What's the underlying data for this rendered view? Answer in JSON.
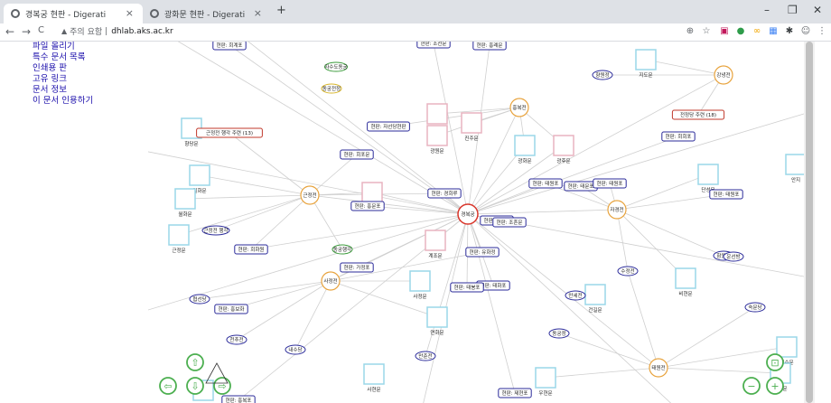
{
  "browser": {
    "tabs": [
      {
        "title": "경복궁 현판 - Digerati",
        "close": "×"
      },
      {
        "title": "광화문 현판 - Digerati",
        "close": "×"
      }
    ],
    "new_tab": "+",
    "window_controls": {
      "minimize": "–",
      "maximize": "❐",
      "close": "✕"
    },
    "nav": {
      "back": "←",
      "forward": "→",
      "reload": "C"
    },
    "url": {
      "security_icon": "▲",
      "security_text": "주의 요함",
      "separator": "|",
      "host": "dhlab.aks.ac.kr"
    }
  },
  "sidebar_menu": [
    "파일 올리기",
    "특수 문서 목록",
    "인쇄용 판",
    "고유 링크",
    "문서 정보",
    "이 문서 인용하기"
  ],
  "graph": {
    "center": "경복궁",
    "nodes": [
      {
        "label": "현판: 회계포",
        "kind": "tag"
      },
      {
        "label": "현판: 조선문",
        "kind": "tag"
      },
      {
        "label": "현판: 흥례문",
        "kind": "tag"
      },
      {
        "label": "지도문",
        "kind": "square"
      },
      {
        "label": "향원정",
        "kind": "ellipse"
      },
      {
        "label": "강녕전",
        "kind": "circle"
      },
      {
        "label": "자수도동궁",
        "kind": "ellipse-green"
      },
      {
        "label": "동궁전정",
        "kind": "ellipse-yellow"
      },
      {
        "label": "흥복전",
        "kind": "circle"
      },
      {
        "label": "전정당 주련 (18)",
        "kind": "tag-red"
      },
      {
        "label": "우정문",
        "kind": "square"
      },
      {
        "label": "현판: 자선당현판",
        "kind": "tag"
      },
      {
        "label": "광원문",
        "kind": "square"
      },
      {
        "label": "진주문",
        "kind": "square"
      },
      {
        "label": "현판: 회회포",
        "kind": "tag"
      },
      {
        "label": "향당문",
        "kind": "square"
      },
      {
        "label": "근정전 행각 주련 (13)",
        "kind": "tag-red"
      },
      {
        "label": "광화문",
        "kind": "square"
      },
      {
        "label": "광후문",
        "kind": "square"
      },
      {
        "label": "현판: 회포문",
        "kind": "tag"
      },
      {
        "label": "안지",
        "kind": "square"
      },
      {
        "label": "일화문",
        "kind": "square"
      },
      {
        "label": "현판: 경회루",
        "kind": "tag"
      },
      {
        "label": "현판: 태원포",
        "kind": "tag"
      },
      {
        "label": "현판: 태문포",
        "kind": "tag"
      },
      {
        "label": "현판: 태원포",
        "kind": "tag"
      },
      {
        "label": "단성문",
        "kind": "square"
      },
      {
        "label": "현판: 태원포",
        "kind": "tag"
      },
      {
        "label": "근정전",
        "kind": "circle"
      },
      {
        "label": "간춘문",
        "kind": "square"
      },
      {
        "label": "현판: 흥문포",
        "kind": "tag"
      },
      {
        "label": "월화문",
        "kind": "square"
      },
      {
        "label": "현판: 화문포",
        "kind": "tag"
      },
      {
        "label": "자경전",
        "kind": "circle"
      },
      {
        "label": "경복궁",
        "kind": "circle-center"
      },
      {
        "label": "현판: 조흔문",
        "kind": "tag"
      },
      {
        "label": "동궁행각",
        "kind": "ellipse-green"
      },
      {
        "label": "근정전 행각",
        "kind": "ellipse"
      },
      {
        "label": "근정문",
        "kind": "square"
      },
      {
        "label": "계조문",
        "kind": "square"
      },
      {
        "label": "현판: 회화원",
        "kind": "tag"
      },
      {
        "label": "현판: 유화정",
        "kind": "tag"
      },
      {
        "label": "함원전",
        "kind": "ellipse"
      },
      {
        "label": "운선방",
        "kind": "ellipse"
      },
      {
        "label": "현판: 가정포",
        "kind": "tag"
      },
      {
        "label": "사정전",
        "kind": "circle"
      },
      {
        "label": "사정문",
        "kind": "square"
      },
      {
        "label": "현판: 태화포",
        "kind": "tag"
      },
      {
        "label": "수정전",
        "kind": "ellipse"
      },
      {
        "label": "건길문",
        "kind": "square"
      },
      {
        "label": "비현문",
        "kind": "square"
      },
      {
        "label": "협선당",
        "kind": "ellipse"
      },
      {
        "label": "만세전",
        "kind": "ellipse"
      },
      {
        "label": "현판: 태봉포",
        "kind": "tag"
      },
      {
        "label": "현판: 흥보화",
        "kind": "tag"
      },
      {
        "label": "연화문",
        "kind": "square"
      },
      {
        "label": "숙문당",
        "kind": "ellipse"
      },
      {
        "label": "천추전",
        "kind": "ellipse"
      },
      {
        "label": "동궁정",
        "kind": "ellipse"
      },
      {
        "label": "내수당",
        "kind": "ellipse"
      },
      {
        "label": "만춘전",
        "kind": "ellipse"
      },
      {
        "label": "신수문",
        "kind": "square"
      },
      {
        "label": "계현문",
        "kind": "square"
      },
      {
        "label": "태원전",
        "kind": "circle"
      },
      {
        "label": "우현문",
        "kind": "square"
      },
      {
        "label": "사현문",
        "kind": "square"
      },
      {
        "label": "현판: 제현포",
        "kind": "tag"
      },
      {
        "label": "협문",
        "kind": "square"
      },
      {
        "label": "현판: 흥복포",
        "kind": "tag"
      }
    ]
  },
  "controls": {
    "pan_up": "pan-up",
    "pan_down": "pan-down",
    "pan_left": "pan-left",
    "pan_right": "pan-right",
    "zoom_in": "zoom-in",
    "zoom_out": "zoom-out",
    "fit": "zoom-extends"
  },
  "colors": {
    "tag_border": "#2b2b9a",
    "tag_red_border": "#c0392b",
    "circle": "#e8a33d",
    "center": "#d9362b",
    "square": "#9ad7e8",
    "square_pink": "#e8b4c0",
    "ellipse_green": "#3a9a3a",
    "ellipse_yellow": "#d7b52a",
    "edge": "#cfcfcf",
    "control": "#4caf50"
  }
}
